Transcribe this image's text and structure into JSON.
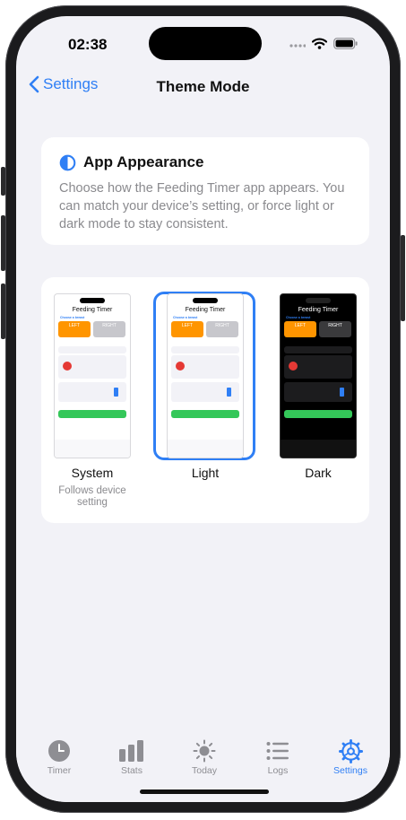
{
  "status": {
    "time": "02:38"
  },
  "nav": {
    "back_label": "Settings",
    "title": "Theme Mode"
  },
  "appearance": {
    "heading": "App Appearance",
    "description": "Choose how the Feeding Timer app appears. You can match your device’s setting, or force light or dark mode to stay consistent."
  },
  "options": [
    {
      "label": "System",
      "sub": "Follows device setting",
      "selected": false
    },
    {
      "label": "Light",
      "sub": "",
      "selected": true
    },
    {
      "label": "Dark",
      "sub": "",
      "selected": false
    }
  ],
  "tabs": [
    {
      "label": "Timer",
      "icon": "clock-icon",
      "active": false
    },
    {
      "label": "Stats",
      "icon": "bar-chart-icon",
      "active": false
    },
    {
      "label": "Today",
      "icon": "sun-icon",
      "active": false
    },
    {
      "label": "Logs",
      "icon": "list-icon",
      "active": false
    },
    {
      "label": "Settings",
      "icon": "gear-icon",
      "active": true
    }
  ],
  "colors": {
    "accent": "#2f7ff5",
    "orange": "#ff9500",
    "green": "#34c759",
    "red": "#e53935"
  }
}
